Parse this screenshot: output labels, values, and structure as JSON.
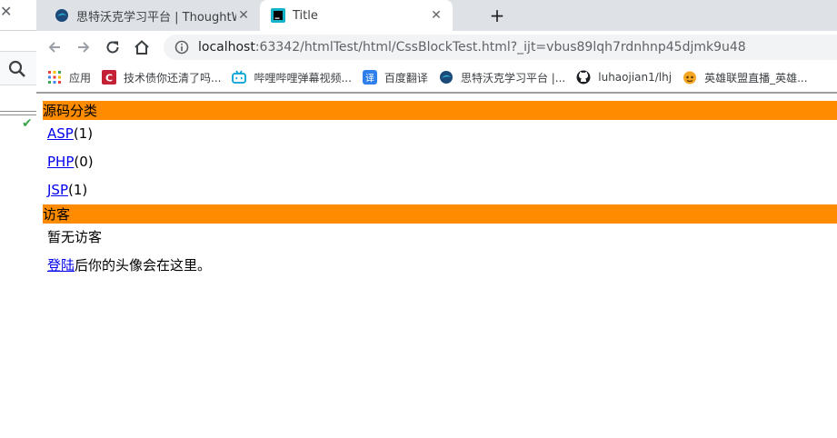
{
  "browser": {
    "tabs": [
      {
        "title": "思特沃克学习平台 | ThoughtWo",
        "active": false
      },
      {
        "title": "Title",
        "active": true
      }
    ],
    "address_bar": {
      "host": "localhost",
      "rest": ":63342/htmlTest/html/CssBlockTest.html?_ijt=vbus89lqh7rdnhnp45djmk9u48"
    },
    "bookmarks": [
      {
        "label": "应用",
        "icon": "apps-grid-icon"
      },
      {
        "label": "技术债你还清了吗...",
        "icon": "csdn-icon"
      },
      {
        "label": "哔哩哔哩弹幕视频...",
        "icon": "bilibili-icon"
      },
      {
        "label": "百度翻译",
        "icon": "translate-icon"
      },
      {
        "label": "思特沃克学习平台 |...",
        "icon": "thoughtworks-icon"
      },
      {
        "label": "luhaojian1/lhj",
        "icon": "github-icon"
      },
      {
        "label": "英雄联盟直播_英雄...",
        "icon": "huya-icon"
      }
    ]
  },
  "page": {
    "sections": [
      {
        "heading": "源码分类",
        "items": [
          {
            "link": "ASP",
            "suffix": "(1)"
          },
          {
            "link": "PHP",
            "suffix": "(0)"
          },
          {
            "link": "JSP",
            "suffix": "(1)"
          }
        ]
      },
      {
        "heading": "访客",
        "text": "暂无访客",
        "login": {
          "link": "登陆",
          "suffix": "后你的头像会在这里。"
        }
      }
    ]
  },
  "colors": {
    "section_header_bg": "#ff8c00",
    "link": "#0000ee"
  }
}
